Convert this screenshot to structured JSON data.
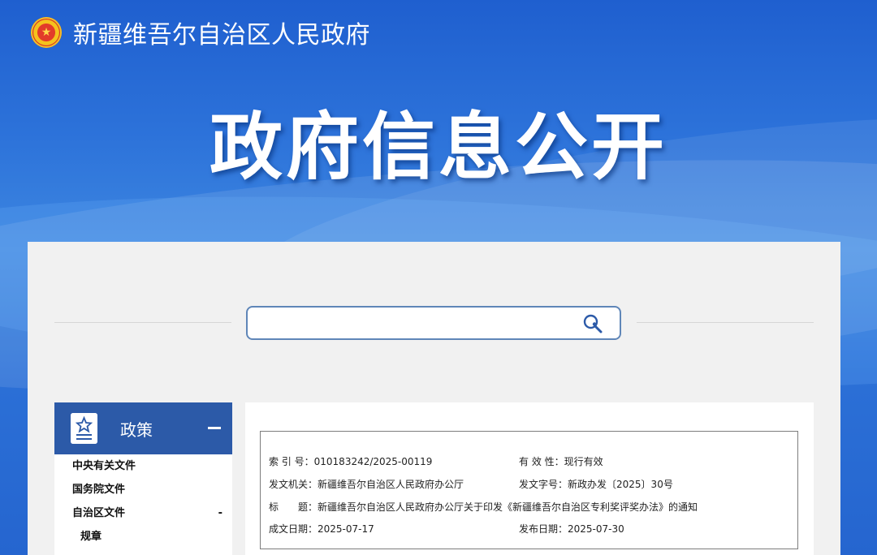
{
  "header": {
    "site_name": "新疆维吾尔自治区人民政府",
    "hero_title": "政府信息公开",
    "emblem_symbol": "★"
  },
  "search": {
    "value": "",
    "placeholder": ""
  },
  "sidebar": {
    "title": "政策",
    "collapse_symbol": "−",
    "items": [
      {
        "label": "中央有关文件"
      },
      {
        "label": "国务院文件"
      },
      {
        "label": "自治区文件",
        "marker": "-"
      },
      {
        "label": "规章"
      }
    ]
  },
  "document_meta": {
    "index_label": "索 引 号：",
    "index_value": "010183242/2025-00119",
    "validity_label": "有 效 性：",
    "validity_value": "现行有效",
    "issuer_label": "发文机关：",
    "issuer_value": "新疆维吾尔自治区人民政府办公厅",
    "doc_no_label": "发文字号：",
    "doc_no_value": "新政办发〔2025〕30号",
    "title_label": "标　　题：",
    "title_value": "新疆维吾尔自治区人民政府办公厅关于印发《新疆维吾尔自治区专利奖评奖办法》的通知",
    "written_label": "成文日期：",
    "written_value": "2025-07-17",
    "published_label": "发布日期：",
    "published_value": "2025-07-30"
  },
  "colors": {
    "banner_blue": "#2f6fd0",
    "sidebar_header": "#2c5aa8",
    "search_border": "#5f86b8",
    "panel_bg": "#f1f1f1"
  }
}
